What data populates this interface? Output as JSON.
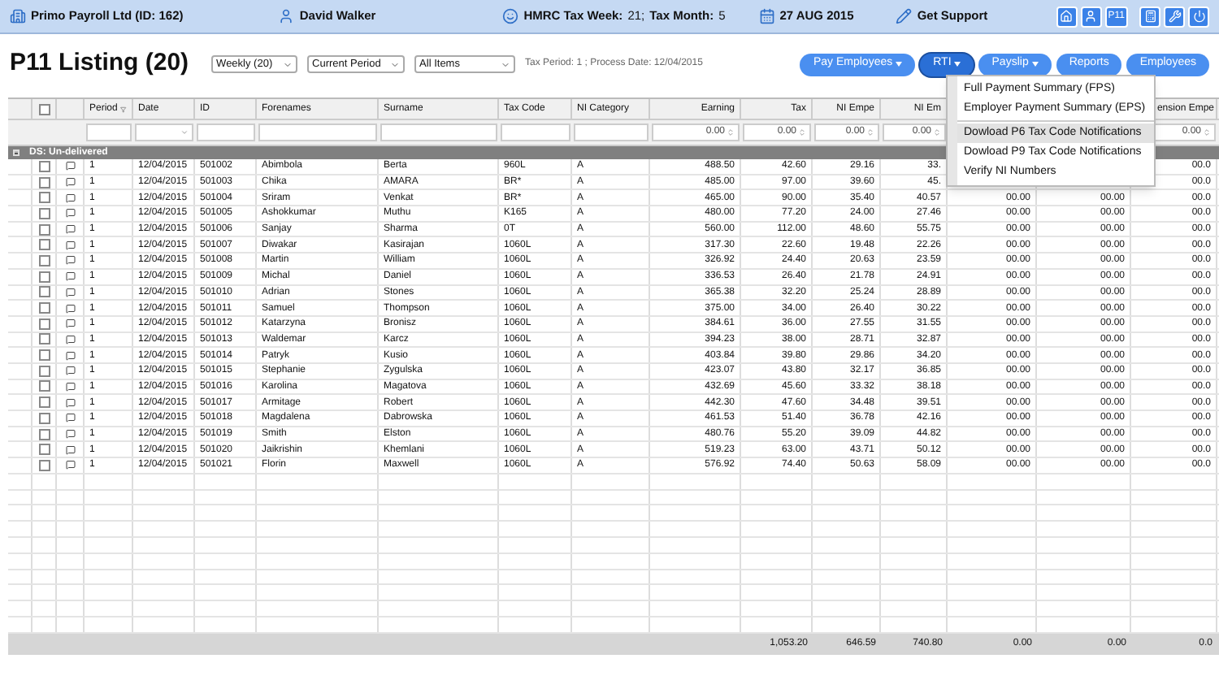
{
  "top_bar": {
    "company": "Primo Payroll Ltd (ID: 162)",
    "user": "David Walker",
    "tax_week_label": "HMRC Tax Week:",
    "tax_week": "21;",
    "tax_month_label": "Tax Month:",
    "tax_month": "5",
    "date": "27 AUG 2015",
    "support": "Get Support",
    "icon_buttons": [
      {
        "kind": "home"
      },
      {
        "kind": "user"
      },
      {
        "kind": "text",
        "label": "P11"
      },
      {
        "kind": "calculator"
      },
      {
        "kind": "wrench"
      },
      {
        "kind": "power"
      }
    ]
  },
  "toolbar": {
    "title": "P11 Listing (20)",
    "selects": [
      {
        "value": "Weekly (20)"
      },
      {
        "value": "Current Period"
      },
      {
        "value": "All Items"
      }
    ],
    "info": "Tax Period: 1 ; Process Date: 12/04/2015",
    "buttons": [
      {
        "label": "Pay Employees",
        "dropdown": true,
        "selected": false
      },
      {
        "label": "RTI",
        "dropdown": true,
        "selected": true
      },
      {
        "label": "Payslip",
        "dropdown": true,
        "selected": false
      },
      {
        "label": "Reports",
        "dropdown": false,
        "selected": false
      },
      {
        "label": "Employees",
        "dropdown": false,
        "selected": false
      }
    ]
  },
  "rti_menu": [
    {
      "kind": "item",
      "label": "Full Payment Summary (FPS)",
      "selected": false
    },
    {
      "kind": "item",
      "label": "Employer Payment Summary (EPS)",
      "selected": false
    },
    {
      "kind": "separator"
    },
    {
      "kind": "item",
      "label": "Dowload P6 Tax Code Notifications",
      "selected": true
    },
    {
      "kind": "item",
      "label": "Dowload P9 Tax Code Notifications",
      "selected": false
    },
    {
      "kind": "item",
      "label": "Verify NI Numbers",
      "selected": false
    }
  ],
  "table": {
    "header_checked": false,
    "headers": {
      "period": "Period",
      "date": "Date",
      "id": "ID",
      "forenames": "Forenames",
      "surname": "Surname",
      "tax_code": "Tax Code",
      "ni_category": "NI Category",
      "earning": "Earning",
      "tax": "Tax",
      "ni_empe": "NI Empe",
      "ni_em": "NI Em",
      "pension": "ension Empe"
    },
    "filters": {
      "date": {
        "kind": "select"
      },
      "id": {
        "kind": "text"
      },
      "forenames": {
        "kind": "text"
      },
      "surname": {
        "kind": "text"
      },
      "tax_code": {
        "kind": "text"
      },
      "ni_category": {
        "kind": "text"
      },
      "period": {
        "kind": "text"
      },
      "earning": {
        "kind": "number",
        "value": "0.00"
      },
      "tax": {
        "kind": "number",
        "value": "0.00"
      },
      "ni_empe": {
        "kind": "number",
        "value": "0.00"
      },
      "ni_em": {
        "kind": "number",
        "value": "0.00"
      },
      "pension": {
        "kind": "number",
        "value": "0.00"
      }
    },
    "group": {
      "label": "DS: Un-delivered",
      "expanded": true
    },
    "rows": [
      {
        "checked": false,
        "period": "1",
        "date": "12/04/2015",
        "id": "501002",
        "forenames": "Abimbola",
        "surname": "Berta",
        "tax_code": "960L",
        "ni_category": "A",
        "earning": "488.50",
        "tax": "42.60",
        "ni_empe": "29.16",
        "ni_em": "33.",
        "pension": "00.0"
      },
      {
        "checked": false,
        "period": "1",
        "date": "12/04/2015",
        "id": "501003",
        "forenames": "Chika",
        "surname": "AMARA",
        "tax_code": "BR*",
        "ni_category": "A",
        "earning": "485.00",
        "tax": "97.00",
        "ni_empe": "39.60",
        "ni_em": "45.",
        "pension": "00.0"
      },
      {
        "checked": false,
        "period": "1",
        "date": "12/04/2015",
        "id": "501004",
        "forenames": "Sriram",
        "surname": "Venkat",
        "tax_code": "BR*",
        "ni_category": "A",
        "earning": "465.00",
        "tax": "90.00",
        "ni_empe": "35.40",
        "ni_em": "40.57",
        "column_14": "00.00",
        "column_15": "00.00",
        "pension": "00.0"
      },
      {
        "checked": false,
        "period": "1",
        "date": "12/04/2015",
        "id": "501005",
        "forenames": "Ashokkumar",
        "surname": "Muthu",
        "tax_code": "K165",
        "ni_category": "A",
        "earning": "480.00",
        "tax": "77.20",
        "ni_empe": "24.00",
        "ni_em": "27.46",
        "column_14": "00.00",
        "column_15": "00.00",
        "pension": "00.0"
      },
      {
        "checked": false,
        "period": "1",
        "date": "12/04/2015",
        "id": "501006",
        "forenames": "Sanjay",
        "surname": "Sharma",
        "tax_code": "0T",
        "ni_category": "A",
        "earning": "560.00",
        "tax": "112.00",
        "ni_empe": "48.60",
        "ni_em": "55.75",
        "column_14": "00.00",
        "column_15": "00.00",
        "pension": "00.0"
      },
      {
        "checked": false,
        "period": "1",
        "date": "12/04/2015",
        "id": "501007",
        "forenames": "Diwakar",
        "surname": "Kasirajan",
        "tax_code": "1060L",
        "ni_category": "A",
        "earning": "317.30",
        "tax": "22.60",
        "ni_empe": "19.48",
        "ni_em": "22.26",
        "column_14": "00.00",
        "column_15": "00.00",
        "pension": "00.0"
      },
      {
        "checked": false,
        "period": "1",
        "date": "12/04/2015",
        "id": "501008",
        "forenames": "Martin",
        "surname": "William",
        "tax_code": "1060L",
        "ni_category": "A",
        "earning": "326.92",
        "tax": "24.40",
        "ni_empe": "20.63",
        "ni_em": "23.59",
        "column_14": "00.00",
        "column_15": "00.00",
        "pension": "00.0"
      },
      {
        "checked": false,
        "period": "1",
        "date": "12/04/2015",
        "id": "501009",
        "forenames": "Michal",
        "surname": "Daniel",
        "tax_code": "1060L",
        "ni_category": "A",
        "earning": "336.53",
        "tax": "26.40",
        "ni_empe": "21.78",
        "ni_em": "24.91",
        "column_14": "00.00",
        "column_15": "00.00",
        "pension": "00.0"
      },
      {
        "checked": false,
        "period": "1",
        "date": "12/04/2015",
        "id": "501010",
        "forenames": "Adrian",
        "surname": "Stones",
        "tax_code": "1060L",
        "ni_category": "A",
        "earning": "365.38",
        "tax": "32.20",
        "ni_empe": "25.24",
        "ni_em": "28.89",
        "column_14": "00.00",
        "column_15": "00.00",
        "pension": "00.0"
      },
      {
        "checked": false,
        "period": "1",
        "date": "12/04/2015",
        "id": "501011",
        "forenames": "Samuel",
        "surname": "Thompson",
        "tax_code": "1060L",
        "ni_category": "A",
        "earning": "375.00",
        "tax": "34.00",
        "ni_empe": "26.40",
        "ni_em": "30.22",
        "column_14": "00.00",
        "column_15": "00.00",
        "pension": "00.0"
      },
      {
        "checked": false,
        "period": "1",
        "date": "12/04/2015",
        "id": "501012",
        "forenames": "Katarzyna",
        "surname": "Bronisz",
        "tax_code": "1060L",
        "ni_category": "A",
        "earning": "384.61",
        "tax": "36.00",
        "ni_empe": "27.55",
        "ni_em": "31.55",
        "column_14": "00.00",
        "column_15": "00.00",
        "pension": "00.0"
      },
      {
        "checked": false,
        "period": "1",
        "date": "12/04/2015",
        "id": "501013",
        "forenames": "Waldemar",
        "surname": "Karcz",
        "tax_code": "1060L",
        "ni_category": "A",
        "earning": "394.23",
        "tax": "38.00",
        "ni_empe": "28.71",
        "ni_em": "32.87",
        "column_14": "00.00",
        "column_15": "00.00",
        "pension": "00.0"
      },
      {
        "checked": false,
        "period": "1",
        "date": "12/04/2015",
        "id": "501014",
        "forenames": "Patryk",
        "surname": "Kusio",
        "tax_code": "1060L",
        "ni_category": "A",
        "earning": "403.84",
        "tax": "39.80",
        "ni_empe": "29.86",
        "ni_em": "34.20",
        "column_14": "00.00",
        "column_15": "00.00",
        "pension": "00.0"
      },
      {
        "checked": false,
        "period": "1",
        "date": "12/04/2015",
        "id": "501015",
        "forenames": "Stephanie",
        "surname": "Zygulska",
        "tax_code": "1060L",
        "ni_category": "A",
        "earning": "423.07",
        "tax": "43.80",
        "ni_empe": "32.17",
        "ni_em": "36.85",
        "column_14": "00.00",
        "column_15": "00.00",
        "pension": "00.0"
      },
      {
        "checked": false,
        "period": "1",
        "date": "12/04/2015",
        "id": "501016",
        "forenames": "Karolina",
        "surname": "Magatova",
        "tax_code": "1060L",
        "ni_category": "A",
        "earning": "432.69",
        "tax": "45.60",
        "ni_empe": "33.32",
        "ni_em": "38.18",
        "column_14": "00.00",
        "column_15": "00.00",
        "pension": "00.0"
      },
      {
        "checked": false,
        "period": "1",
        "date": "12/04/2015",
        "id": "501017",
        "forenames": "Armitage",
        "surname": "Robert",
        "tax_code": "1060L",
        "ni_category": "A",
        "earning": "442.30",
        "tax": "47.60",
        "ni_empe": "34.48",
        "ni_em": "39.51",
        "column_14": "00.00",
        "column_15": "00.00",
        "pension": "00.0"
      },
      {
        "checked": false,
        "period": "1",
        "date": "12/04/2015",
        "id": "501018",
        "forenames": "Magdalena",
        "surname": "Dabrowska",
        "tax_code": "1060L",
        "ni_category": "A",
        "earning": "461.53",
        "tax": "51.40",
        "ni_empe": "36.78",
        "ni_em": "42.16",
        "column_14": "00.00",
        "column_15": "00.00",
        "pension": "00.0"
      },
      {
        "checked": false,
        "period": "1",
        "date": "12/04/2015",
        "id": "501019",
        "forenames": "Smith",
        "surname": "Elston",
        "tax_code": "1060L",
        "ni_category": "A",
        "earning": "480.76",
        "tax": "55.20",
        "ni_empe": "39.09",
        "ni_em": "44.82",
        "column_14": "00.00",
        "column_15": "00.00",
        "pension": "00.0"
      },
      {
        "checked": false,
        "period": "1",
        "date": "12/04/2015",
        "id": "501020",
        "forenames": "Jaikrishin",
        "surname": "Khemlani",
        "tax_code": "1060L",
        "ni_category": "A",
        "earning": "519.23",
        "tax": "63.00",
        "ni_empe": "43.71",
        "ni_em": "50.12",
        "column_14": "00.00",
        "column_15": "00.00",
        "pension": "00.0"
      },
      {
        "checked": false,
        "period": "1",
        "date": "12/04/2015",
        "id": "501021",
        "forenames": "Florin",
        "surname": "Maxwell",
        "tax_code": "1060L",
        "ni_category": "A",
        "earning": "576.92",
        "tax": "74.40",
        "ni_empe": "50.63",
        "ni_em": "58.09",
        "column_14": "00.00",
        "column_15": "00.00",
        "pension": "00.0"
      }
    ],
    "totals": {
      "tax": "1,053.20",
      "ni_empe": "646.59",
      "ni_em": "740.80",
      "column_14": "0.00",
      "column_15": "0.00",
      "pension": "0.0"
    }
  }
}
